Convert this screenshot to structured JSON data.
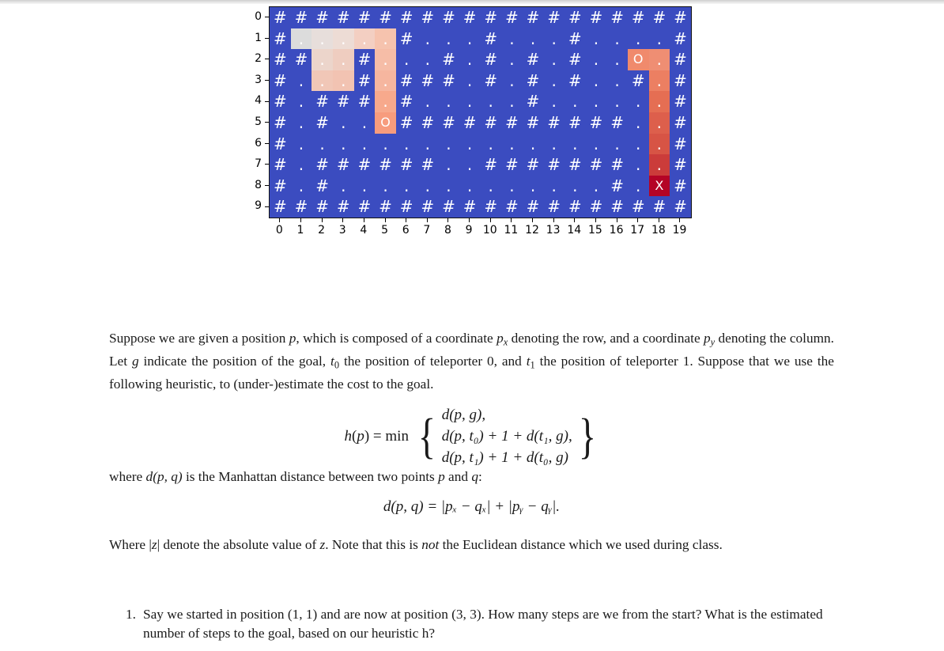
{
  "figure": {
    "row_labels": [
      "0",
      "1",
      "2",
      "3",
      "4",
      "5",
      "6",
      "7",
      "8",
      "9"
    ],
    "col_labels": [
      "0",
      "1",
      "2",
      "3",
      "4",
      "5",
      "6",
      "7",
      "8",
      "9",
      "10",
      "11",
      "12",
      "13",
      "14",
      "15",
      "16",
      "17",
      "18",
      "19"
    ],
    "colors": {
      "wall_background": "#3b4cc0",
      "path_light": "#dddddd",
      "path_mid": "#f2c0ab",
      "path_warm": "#f6a385",
      "path_hot": "#e26a52",
      "goal": "#b40426",
      "text": "#ffffff",
      "border": "#111111"
    },
    "legend_symbols": {
      "wall": "#",
      "open": ".",
      "teleporter": "O",
      "goal": "X"
    },
    "grid": [
      [
        "#",
        "#",
        "#",
        "#",
        "#",
        "#",
        "#",
        "#",
        "#",
        "#",
        "#",
        "#",
        "#",
        "#",
        "#",
        "#",
        "#",
        "#",
        "#",
        "#"
      ],
      [
        "#",
        ".",
        ".",
        ".",
        ".",
        ".",
        "#",
        ".",
        ".",
        ".",
        "#",
        ".",
        ".",
        ".",
        "#",
        ".",
        ".",
        ".",
        ".",
        "#"
      ],
      [
        "#",
        "#",
        ".",
        ".",
        "#",
        ".",
        ".",
        ".",
        "#",
        ".",
        "#",
        ".",
        "#",
        ".",
        "#",
        ".",
        ".",
        "O",
        ".",
        "#"
      ],
      [
        "#",
        ".",
        ".",
        ".",
        "#",
        ".",
        "#",
        "#",
        "#",
        ".",
        "#",
        ".",
        "#",
        ".",
        "#",
        ".",
        ".",
        "#",
        ".",
        "#"
      ],
      [
        "#",
        ".",
        "#",
        "#",
        "#",
        ".",
        "#",
        ".",
        ".",
        ".",
        ".",
        ".",
        "#",
        ".",
        ".",
        ".",
        ".",
        ".",
        ".",
        "#"
      ],
      [
        "#",
        ".",
        "#",
        ".",
        ".",
        "O",
        "#",
        "#",
        "#",
        "#",
        "#",
        "#",
        "#",
        "#",
        "#",
        "#",
        "#",
        ".",
        ".",
        "#"
      ],
      [
        "#",
        ".",
        ".",
        ".",
        ".",
        ".",
        ".",
        ".",
        ".",
        ".",
        ".",
        ".",
        ".",
        ".",
        ".",
        ".",
        ".",
        ".",
        ".",
        "#"
      ],
      [
        "#",
        ".",
        "#",
        "#",
        "#",
        "#",
        "#",
        "#",
        ".",
        ".",
        "#",
        "#",
        "#",
        "#",
        "#",
        "#",
        "#",
        ".",
        ".",
        "#"
      ],
      [
        "#",
        ".",
        "#",
        ".",
        ".",
        ".",
        ".",
        ".",
        ".",
        ".",
        ".",
        ".",
        ".",
        ".",
        ".",
        ".",
        "#",
        ".",
        "X",
        "#"
      ],
      [
        "#",
        "#",
        "#",
        "#",
        "#",
        "#",
        "#",
        "#",
        "#",
        "#",
        "#",
        "#",
        "#",
        "#",
        "#",
        "#",
        "#",
        "#",
        "#",
        "#"
      ]
    ],
    "highlight": [
      [
        "",
        "",
        "",
        "",
        "",
        "",
        "",
        "",
        "",
        "",
        "",
        "",
        "",
        "",
        "",
        "",
        "",
        "",
        "",
        ""
      ],
      [
        "",
        "#dcdcdc",
        "#e7dedb",
        "#eddcd5",
        "#f3cfc2",
        "#f6c3ae",
        "",
        "",
        "",
        "",
        "",
        "",
        "",
        "",
        "",
        "",
        "",
        "",
        "",
        ""
      ],
      [
        "",
        "",
        "#ecd5cb",
        "#efcdc0",
        "",
        "#f6bda7",
        "",
        "",
        "",
        "",
        "",
        "",
        "",
        "",
        "",
        "",
        "",
        "#f08a6c",
        "#ef8e73",
        ""
      ],
      [
        "",
        "",
        "#f1c7b7",
        "#f2c3b2",
        "",
        "#f6b69f",
        "",
        "",
        "",
        "",
        "",
        "",
        "",
        "",
        "",
        "",
        "",
        "",
        "#ec7f62",
        ""
      ],
      [
        "",
        "",
        "",
        "",
        "",
        "#f7a98c",
        "",
        "",
        "",
        "",
        "",
        "",
        "",
        "",
        "",
        "",
        "",
        "",
        "#e56e53",
        ""
      ],
      [
        "",
        "",
        "",
        "",
        "",
        "#f79c7d",
        "",
        "",
        "",
        "",
        "",
        "",
        "",
        "",
        "",
        "",
        "",
        "",
        "#dd5f4c",
        ""
      ],
      [
        "",
        "",
        "",
        "",
        "",
        "",
        "",
        "",
        "",
        "",
        "",
        "",
        "",
        "",
        "",
        "",
        "",
        "",
        "#d75445",
        ""
      ],
      [
        "",
        "",
        "",
        "",
        "",
        "",
        "",
        "",
        "",
        "",
        "",
        "",
        "",
        "",
        "",
        "",
        "",
        "",
        "#cb3c3a",
        ""
      ],
      [
        "",
        "",
        "",
        "",
        "",
        "",
        "",
        "",
        "",
        "",
        "",
        "",
        "",
        "",
        "",
        "",
        "",
        "",
        "#b40426",
        ""
      ],
      [
        "",
        "",
        "",
        "",
        "",
        "",
        "",
        "",
        "",
        "",
        "",
        "",
        "",
        "",
        "",
        "",
        "",
        "",
        "",
        ""
      ]
    ]
  },
  "body": {
    "paragraph1": {
      "p1_a": "Suppose we are given a position ",
      "p1_p": "p",
      "p1_b": ", which is composed of a coordinate ",
      "p1_px": "p",
      "p1_px_sub": "x",
      "p1_c": " denoting the row, and a coordinate ",
      "p1_py": "p",
      "p1_py_sub": "y",
      "p1_d": " denoting the column. Let ",
      "p1_g": "g",
      "p1_e": " indicate the position of the goal, ",
      "p1_t0": "t",
      "p1_t0_sub": "0",
      "p1_f": " the position of teleporter 0, and ",
      "p1_t1": "t",
      "p1_t1_sub": "1",
      "p1_g2": " the position of teleporter 1. Suppose that we use the following heuristic, to (under-)estimate the cost to the goal."
    },
    "equation_h": {
      "lhs_h": "h",
      "lhs_open": "(",
      "lhs_p": "p",
      "lhs_close": ") = ",
      "min": "min",
      "brace_left": "{",
      "brace_right": "}",
      "case1": "d(p, g),",
      "case2": "d(p, t₀) + 1 + d(t₁, g),",
      "case3": "d(p, t₁) + 1 + d(t₀, g)"
    },
    "paragraph2": {
      "a": "where ",
      "d": "d",
      "args": "(p, q)",
      "b": " is the Manhattan distance between two points ",
      "p": "p",
      "c": " and ",
      "q": "q",
      "d2": ":"
    },
    "equation_d": {
      "text": "d(p, q) = |pₓ − qₓ| + |pᵧ − qᵧ|."
    },
    "paragraph3": {
      "a": "Where |",
      "z": "z",
      "b": "| denote the absolute value of ",
      "z2": "z",
      "c": ". Note that this is ",
      "not": "not",
      "d": " the Euclidean distance which we used during class."
    },
    "questions": [
      {
        "number": "1.",
        "text": "Say we started in position (1, 1) and are now at position (3, 3). How many steps are we from the start? What is the estimated number of steps to the goal, based on our heuristic h?"
      }
    ]
  }
}
